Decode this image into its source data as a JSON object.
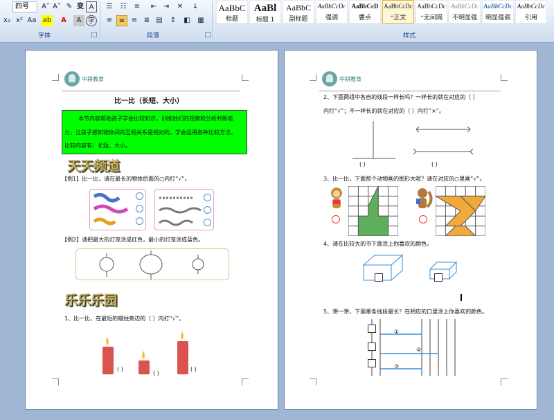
{
  "ribbon": {
    "font_size": "四号",
    "font_group_label": "字体",
    "paragraph_group_label": "段落",
    "styles_group_label": "样式",
    "styles": [
      {
        "sample": "AaBbC",
        "name": "标题"
      },
      {
        "sample": "AaBl",
        "name": "标题 1"
      },
      {
        "sample": "AaBbC",
        "name": "副标题"
      },
      {
        "sample": "AaBbCcDc",
        "name": "强调"
      },
      {
        "sample": "AaBbCcD",
        "name": "要点"
      },
      {
        "sample": "AaBbCcDc",
        "name": "⁺正文"
      },
      {
        "sample": "AaBbCcDc",
        "name": "⁺无间隔"
      },
      {
        "sample": "AaBbCcDc",
        "name": "不明显强调"
      },
      {
        "sample": "AaBbCcDc",
        "name": "明显强调"
      },
      {
        "sample": "AaBbCcDc",
        "name": "引用"
      }
    ]
  },
  "page1": {
    "logo": "中耕教育",
    "title": "比一比（长短、大小）",
    "intro_lines": [
      "本节内容帮助孩子学会比较知识，训练他们的观察和分析判断能",
      "力，让孩子感知物体间的互相关系是相对的，学会运用各种比较方法。",
      "比较内容有：长短、大小。"
    ],
    "section1": "天天频道",
    "ex1": "【例1】比一比，请在最长的物体后面的○内打“√”。",
    "ex2": "【例2】请把最大的灯笼涂成红色，最小的灯笼涂成蓝色。",
    "section2": "乐乐乐园",
    "q1": "1、比一比，在最短的蜡烛旁边的（     ）内打“√”。",
    "paren": "(     )"
  },
  "page2": {
    "logo": "中耕教育",
    "q2a": "2、下面两组中各自的线段一样长吗？一样长的就在对应的（     ）",
    "q2b": "内打“√”；不一样长的就在对应的（     ）内打“×”。",
    "paren": "(     )",
    "q3": "3、比一比，下面那个动物画的图形大呢？请在对应的○里画“√”。",
    "q4": "4、请在比较大的书下面涂上你喜欢的颜色。",
    "q5": "5、想一想，下面哪条线段最长？在相应的口里涂上你喜欢的颜色。",
    "n1": "①",
    "n2": "②",
    "n3": "③"
  },
  "colors": {
    "highlight": "#00ff00",
    "shape_green": "#5fae5c",
    "shape_orange": "#f2a93b"
  }
}
